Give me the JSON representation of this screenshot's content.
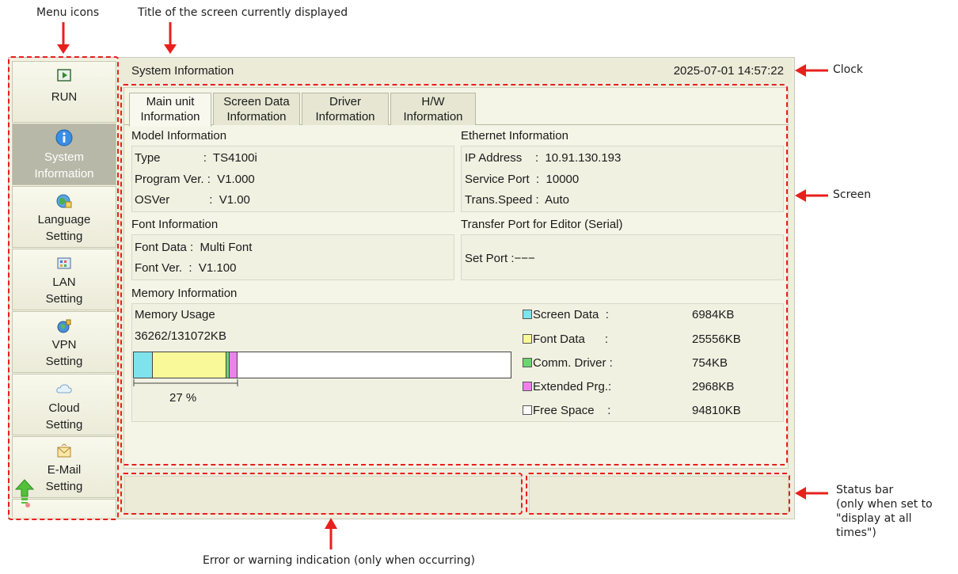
{
  "annotations": {
    "menu_icons": "Menu icons",
    "title": "Title of the screen currently displayed",
    "clock": "Clock",
    "screen": "Screen",
    "status_bar_line1": "Status bar",
    "status_bar_line2": "(only when set to",
    "status_bar_line3": "\"display at all",
    "status_bar_line4": "times\")",
    "error": "Error or warning indication (only when occurring)"
  },
  "menu": {
    "items": [
      {
        "line1": "RUN",
        "line2": "",
        "icon": "run-icon"
      },
      {
        "line1": "System",
        "line2": "Information",
        "icon": "info-icon"
      },
      {
        "line1": "Language",
        "line2": "Setting",
        "icon": "globe-icon"
      },
      {
        "line1": "LAN",
        "line2": "Setting",
        "icon": "lan-icon"
      },
      {
        "line1": "VPN",
        "line2": "Setting",
        "icon": "vpn-icon"
      },
      {
        "line1": "Cloud",
        "line2": "Setting",
        "icon": "cloud-icon"
      },
      {
        "line1": "E-Mail",
        "line2": "Setting",
        "icon": "mail-icon"
      }
    ]
  },
  "titlebar": {
    "title": "System Information",
    "clock": "2025-07-01  14:57:22"
  },
  "tabs": [
    {
      "line1": "Main unit",
      "line2": "Information"
    },
    {
      "line1": "Screen Data",
      "line2": "Information"
    },
    {
      "line1": "Driver",
      "line2": "Information"
    },
    {
      "line1": "H/W",
      "line2": "Information"
    }
  ],
  "model": {
    "heading": "Model Information",
    "type": "Type             :  TS4100i",
    "program": "Program Ver. :  V1.000",
    "os": "OSVer            :  V1.00"
  },
  "ethernet": {
    "heading": "Ethernet Information",
    "ip": "IP Address    :  10.91.130.193",
    "port": "Service Port  :  10000",
    "speed": "Trans.Speed :  Auto"
  },
  "font": {
    "heading": "Font Information",
    "data": "Font Data :  Multi Font",
    "ver": "Font Ver.  :  V1.100"
  },
  "transfer": {
    "heading": "Transfer Port for Editor (Serial)",
    "port": "Set Port :−−−"
  },
  "memory": {
    "heading": "Memory Information",
    "usage_label": "Memory Usage",
    "usage_value": "36262/131072KB",
    "percent": "27 %",
    "colors": {
      "screen": "#7fe3ee",
      "font": "#f9f99a",
      "driver": "#6ed46e",
      "ext": "#ee80ee",
      "free": "#ffffff"
    },
    "legend": [
      {
        "label": "Screen Data  :",
        "value": "6984KB"
      },
      {
        "label": "Font Data      :",
        "value": "25556KB"
      },
      {
        "label": "Comm. Driver :",
        "value": "754KB"
      },
      {
        "label": "Extended Prg.:",
        "value": "2968KB"
      },
      {
        "label": "Free Space    :",
        "value": "94810KB"
      }
    ]
  }
}
